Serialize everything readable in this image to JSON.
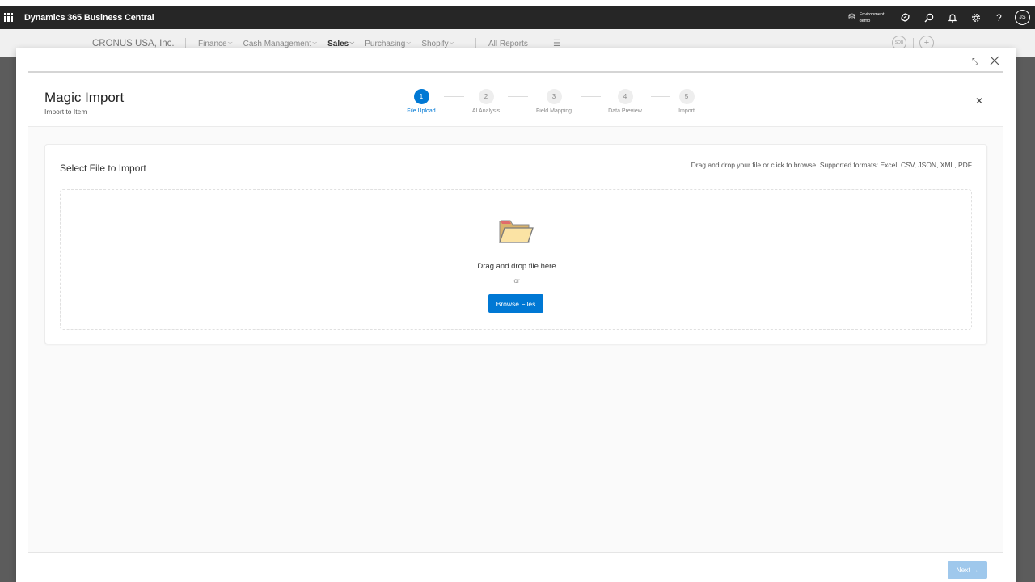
{
  "appbar": {
    "app_name": "Dynamics 365 Business Central",
    "environment_label": "Environment:",
    "environment_value": "demo",
    "user_initials": "JS"
  },
  "navbar": {
    "company": "CRONUS USA, Inc.",
    "items": [
      {
        "label": "Finance",
        "active": false
      },
      {
        "label": "Cash Management",
        "active": false
      },
      {
        "label": "Sales",
        "active": true
      },
      {
        "label": "Purchasing",
        "active": false
      },
      {
        "label": "Shopify",
        "active": false
      }
    ],
    "all_reports": "All Reports",
    "circle_left_label": "SOB"
  },
  "dialog": {
    "title": "Magic Import",
    "subtitle": "Import to Item",
    "steps": [
      {
        "number": "1",
        "label": "File Upload",
        "active": true
      },
      {
        "number": "2",
        "label": "AI Analysis",
        "active": false
      },
      {
        "number": "3",
        "label": "Field Mapping",
        "active": false
      },
      {
        "number": "4",
        "label": "Data Preview",
        "active": false
      },
      {
        "number": "5",
        "label": "Import",
        "active": false
      }
    ],
    "card": {
      "title": "Select File to Import",
      "hint": "Drag and drop your file or click to browse. Supported formats: Excel, CSV, JSON, XML, PDF",
      "drop_text": "Drag and drop file here",
      "or_text": "or",
      "browse_label": "Browse Files"
    },
    "next_label": "Next →"
  },
  "colors": {
    "accent": "#0078d4",
    "appbar_bg": "#262626",
    "next_disabled": "#9fc8ec"
  }
}
